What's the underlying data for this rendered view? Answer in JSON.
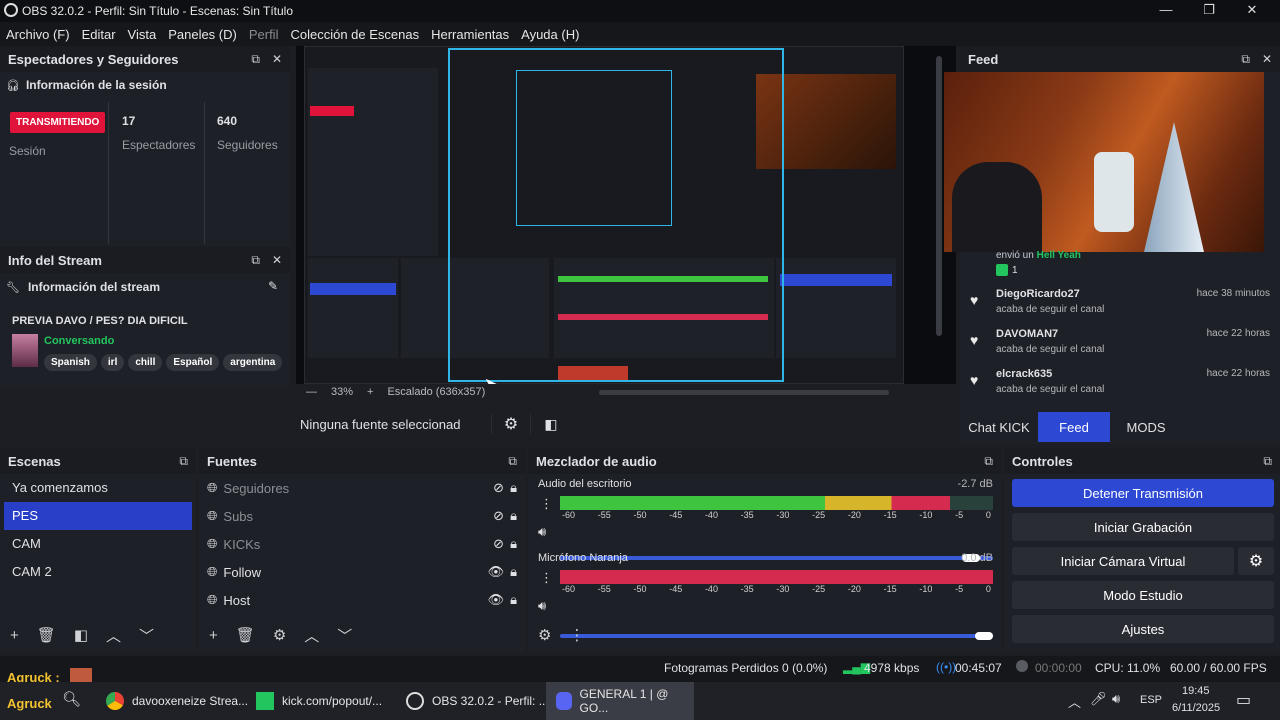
{
  "window": {
    "title": "OBS 32.0.2 - Perfil: Sin Título - Escenas: Sin Título"
  },
  "menu": [
    "Archivo (F)",
    "Editar",
    "Vista",
    "Paneles (D)",
    "Perfil",
    "Colección de Escenas",
    "Herramientas",
    "Ayuda (H)"
  ],
  "viewers_dock": {
    "title": "Espectadores y Seguidores",
    "section": "Información de la sesión",
    "live_badge": "TRANSMITIENDO",
    "session_label": "Sesión",
    "viewers_value": "17",
    "viewers_label": "Espectadores",
    "followers_value": "640",
    "followers_label": "Seguidores"
  },
  "stream_info": {
    "title": "Info del Stream",
    "section": "Información del stream",
    "stream_title": "PREVIA DAVO / PES? DIA DIFICIL",
    "category": "Conversando",
    "tags": [
      "Spanish",
      "irl",
      "chill",
      "Español",
      "argentina"
    ]
  },
  "preview": {
    "zoom": "33%",
    "scaling": "Escalado (636x357)",
    "no_source": "Ninguna fuente seleccionad"
  },
  "feed": {
    "title": "Feed",
    "partial_line1": "envió un",
    "partial_name": "Hell Yeah",
    "partial_count": "1",
    "entries": [
      {
        "name": "DiegoRicardo27",
        "time": "hace 38 minutos",
        "action": "acaba de seguir el canal"
      },
      {
        "name": "DAVOMAN7",
        "time": "hace 22 horas",
        "action": "acaba de seguir el canal"
      },
      {
        "name": "elcrack635",
        "time": "hace 22 horas",
        "action": "acaba de seguir el canal"
      }
    ],
    "tabs": [
      "Chat KICK",
      "Feed",
      "MODS"
    ]
  },
  "scenes": {
    "title": "Escenas",
    "items": [
      "Ya comenzamos",
      "PES",
      "CAM",
      "CAM 2"
    ]
  },
  "sources": {
    "title": "Fuentes",
    "items": [
      "Seguidores",
      "Subs",
      "KICKs",
      "Follow",
      "Host"
    ]
  },
  "mixer": {
    "title": "Mezclador de audio",
    "ticks": [
      "-60",
      "-55",
      "-50",
      "-45",
      "-40",
      "-35",
      "-30",
      "-25",
      "-20",
      "-15",
      "-10",
      "-5",
      "0"
    ],
    "channels": [
      {
        "name": "Audio del escritorio",
        "db": "-2.7 dB",
        "level": 0.9,
        "volume": 0.97
      },
      {
        "name": "Micrófono Naranja",
        "db": "0.0 dB",
        "level": 1.0,
        "volume": 1.0
      }
    ]
  },
  "controls": {
    "title": "Controles",
    "stop_stream": "Detener Transmisión",
    "start_record": "Iniciar Grabación",
    "virtual_cam": "Iniciar Cámara Virtual",
    "studio_mode": "Modo Estudio",
    "settings": "Ajustes"
  },
  "status": {
    "dropped": "Fotogramas Perdidos 0 (0.0%)",
    "bitrate": "4978 kbps",
    "stream_time": "00:45:07",
    "rec_time": "00:00:00",
    "cpu": "CPU: 11.0%",
    "fps": "60.00 / 60.00 FPS"
  },
  "chat_overlay": {
    "user1": "Agruck :",
    "user2": "Agruck"
  },
  "taskbar": {
    "items": [
      "davooxeneize Strea...",
      "kick.com/popout/...",
      "OBS 32.0.2 - Perfil: ...",
      "GENERAL 1 | @ GO..."
    ],
    "lang": "ESP",
    "time": "19:45",
    "date": "6/11/2025"
  },
  "colors": {
    "accent": "#2d48d3",
    "live": "#e0133a",
    "green": "#22c55e",
    "meter_green": "#3ec43e",
    "meter_yellow": "#d6b52a",
    "meter_red": "#d42b4f"
  }
}
